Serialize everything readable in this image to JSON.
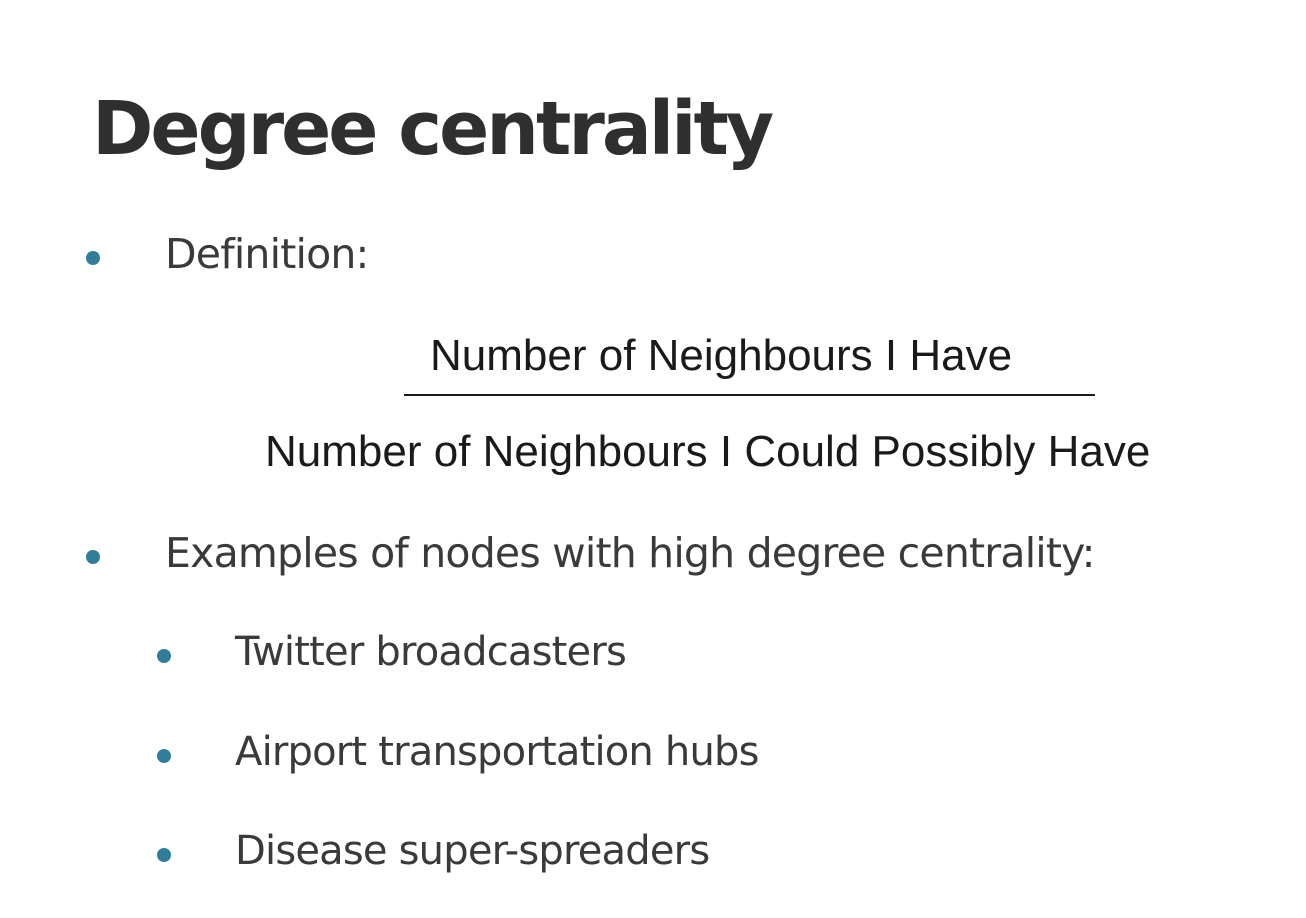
{
  "slide": {
    "title": "Degree centrality",
    "bullets": [
      {
        "text": "Definition:"
      },
      {
        "text": "Examples of nodes with high degree centrality:"
      }
    ],
    "definition_fraction": {
      "numerator": "Number of Neighbours I Have",
      "denominator": "Number of Neighbours I Could Possibly Have"
    },
    "examples": [
      {
        "text": "Twitter broadcasters"
      },
      {
        "text": "Airport transportation hubs"
      },
      {
        "text": "Disease super-spreaders"
      }
    ]
  },
  "colors": {
    "bullet": "#2f7d99",
    "text": "#3a3a3a",
    "title": "#2f2f2f"
  }
}
